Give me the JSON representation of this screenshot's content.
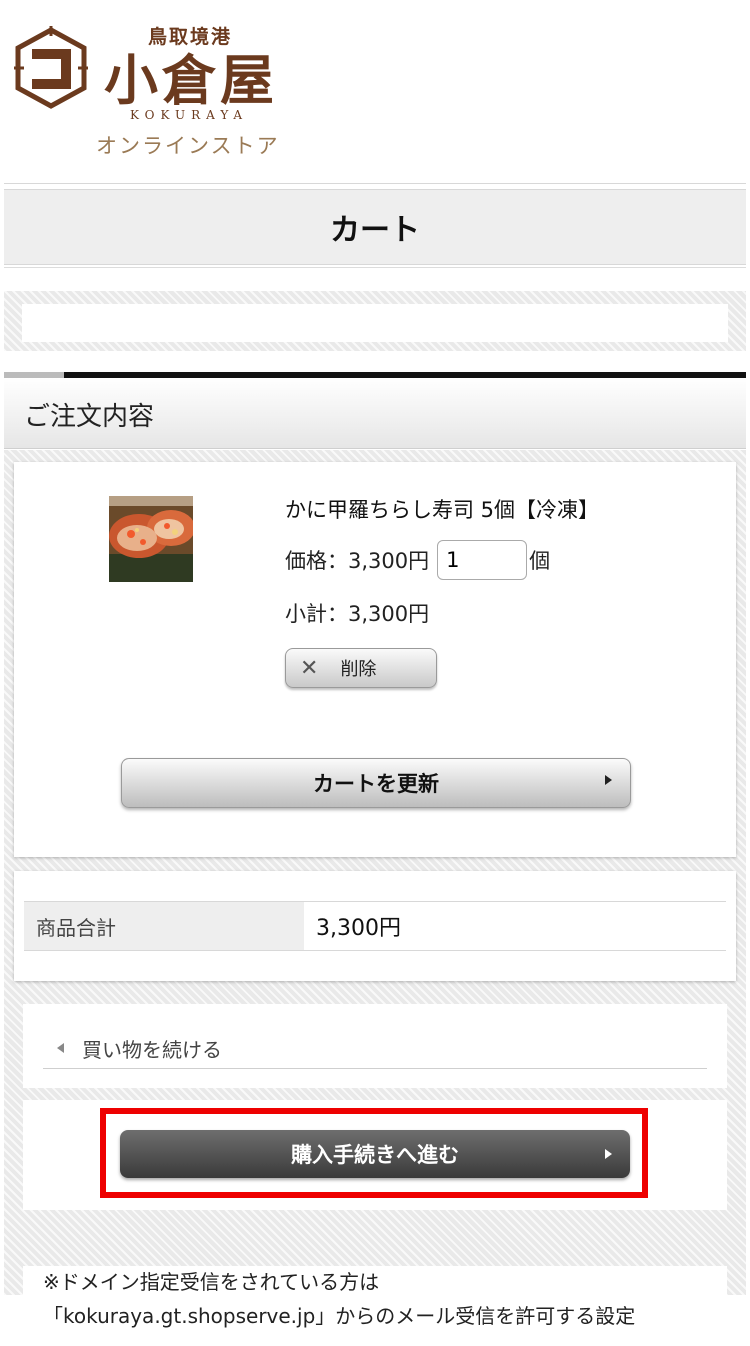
{
  "logo": {
    "tagline": "鳥取境港",
    "brand": "小倉屋",
    "roman": "KOKURAYA",
    "store": "オンラインストア",
    "brand_color": "#6b3a1e"
  },
  "page_title": "カート",
  "section_title": "ご注文内容",
  "item": {
    "name": "かに甲羅ちらし寿司 5個【冷凍】",
    "price_label": "価格：3,300円",
    "quantity": "1",
    "unit": "個",
    "subtotal_label": "小計：3,300円",
    "delete_label": "削除",
    "thumbnail": "crab-shell-sushi-photo"
  },
  "update_label": "カートを更新",
  "totals": {
    "label": "商品合計",
    "value": "3,300円"
  },
  "continue_label": "買い物を続ける",
  "checkout_label": "購入手続きへ進む",
  "highlight_color": "#ee0000",
  "notice": {
    "line1": "※ドメイン指定受信をされている方は",
    "line2": "「kokuraya.gt.shopserve.jp」からのメール受信を許可する設定"
  }
}
